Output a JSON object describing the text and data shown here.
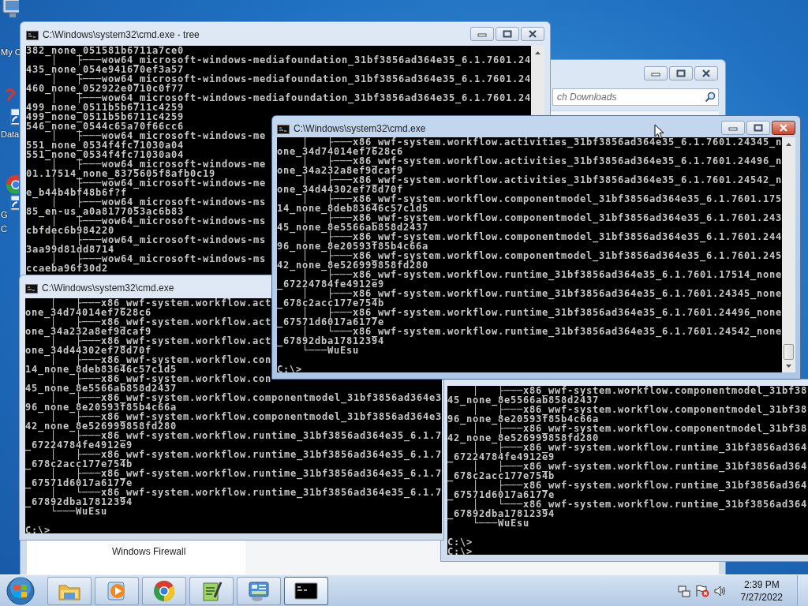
{
  "desktop_icons": [
    {
      "label": [
        "My C"
      ]
    },
    {
      "label": [
        "Data"
      ]
    },
    {
      "label": [
        "G",
        "C"
      ]
    }
  ],
  "explorer": {
    "search": {
      "placeholder": "ch Downloads"
    },
    "nav_items": [
      "Windows Firewall"
    ]
  },
  "windows": [
    {
      "title": "C:\\Windows\\system32\\cmd.exe - tree",
      "active": false,
      "lines": [
        "382_none_051581b6711a7ce0",
        "    │   ├───wow64_microsoft-windows-mediafoundation_31bf3856ad364e35_6.1.7601.24",
        "435_none_054e941670ef3a57",
        "    │   ├───wow64_microsoft-windows-mediafoundation_31bf3856ad364e35_6.1.7601.24",
        "460_none_052922e0710c0f77",
        "    │   ├───wow64_microsoft-windows-mediafoundation_31bf3856ad364e35_6.1.7601.24",
        "499_none_0511b5b6711c4259",
        "499_none_0511b5b6711c4259",
        "546_none_0544c65a70f66cc6",
        "    │   ├───wow64_microsoft-windows-me",
        "551_none_0534f4fc71030a04",
        "551_none_0534f4fc71030a04",
        "    │   ├───wow64_microsoft-windows-me",
        "01.17514_none_8375605f8afb0c19",
        "    │   ├───wow64_microsoft-windows-me",
        "e_b44b4bf48b6f?f",
        "    │   ├───wow64_microsoft-windows-ms",
        "85_en-us_a0a8177053ac6b83",
        "    │   ├───wow64_microsoft-windows-ms",
        "cbfdec6b984220",
        "    │   ├───wow64_microsoft-windows-ms",
        "3aa99d81dd8714",
        "    │   ├───wow64_microsoft-windows-ms",
        "ccaeba96f30d2"
      ]
    },
    {
      "title": "C:\\Windows\\system32\\cmd.exe",
      "active": true,
      "lines": [
        "    │   ├───x86_wwf-system.workflow.activities_31bf3856ad364e35_6.1.7601.24345_n",
        "one_34d74014ef7628c6",
        "    │   ├───x86_wwf-system.workflow.activities_31bf3856ad364e35_6.1.7601.24496_n",
        "one_34a232a8ef9dcaf9",
        "    │   ├───x86_wwf-system.workflow.activities_31bf3856ad364e35_6.1.7601.24542_n",
        "one_34d44302ef78d70f",
        "    │   ├───x86_wwf-system.workflow.componentmodel_31bf3856ad364e35_6.1.7601.175",
        "14_none_8deb83646c57c1d5",
        "    │   ├───x86_wwf-system.workflow.componentmodel_31bf3856ad364e35_6.1.7601.243",
        "45_none_8e5566ab858d2437",
        "    │   ├───x86_wwf-system.workflow.componentmodel_31bf3856ad364e35_6.1.7601.244",
        "96_none_8e20593f85b4c66a",
        "    │   ├───x86_wwf-system.workflow.componentmodel_31bf3856ad364e35_6.1.7601.245",
        "42_none_8e526999858fd280",
        "    │   ├───x86_wwf-system.workflow.runtime_31bf3856ad364e35_6.1.7601.17514_none",
        "_67224784fe4912e9",
        "    │   ├───x86_wwf-system.workflow.runtime_31bf3856ad364e35_6.1.7601.24345_none",
        "_678c2acc177e754b",
        "    │   ├───x86_wwf-system.workflow.runtime_31bf3856ad364e35_6.1.7601.24496_none",
        "_67571d6017a6177e",
        "    │   └───x86_wwf-system.workflow.runtime_31bf3856ad364e35_6.1.7601.24542_none",
        "_67892dba17812394",
        "    └───WuEsu"
      ],
      "prompts": [
        "C:\\>"
      ]
    },
    {
      "title": "C:\\Windows\\system32\\cmd.exe",
      "active": false,
      "lines": [
        "    │   ├───x86_wwf-system.workflow.act",
        "one_34d74014ef7628c6",
        "    │   ├───x86_wwf-system.workflow.act",
        "one_34a232a8ef9dcaf9",
        "    │   ├───x86_wwf-system.workflow.act",
        "one_34d44302ef78d70f",
        "    │   ├───x86_wwf-system.workflow.con",
        "14_none_8deb83646c57c1d5",
        "    │   ├───x86_wwf-system.workflow.con",
        "45_none_8e5566ab858d2437",
        "    │   ├───x86_wwf-system.workflow.componentmodel_31bf3856ad364e3",
        "96_none_8e20593f85b4c66a",
        "    │   ├───x86_wwf-system.workflow.componentmodel_31bf3856ad364e3",
        "42_none_8e526999858fd280",
        "    │   ├───x86_wwf-system.workflow.runtime_31bf3856ad364e35_6.1.7",
        "_67224784fe4912e9",
        "    │   ├───x86_wwf-system.workflow.runtime_31bf3856ad364e35_6.1.7",
        "_678c2acc177e754b",
        "    │   ├───x86_wwf-system.workflow.runtime_31bf3856ad364e35_6.1.7",
        "_67571d6017a6177e",
        "    │   └───x86_wwf-system.workflow.runtime_31bf3856ad364e35_6.1.7",
        "_67892dba17812394",
        "    └───WuEsu"
      ],
      "prompts": [
        "C:\\>"
      ]
    },
    {
      "active": false,
      "lines": [
        "    │   ├───x86_wwf-system.workflow.componentmodel_31bf38",
        "45_none_8e5566ab858d2437",
        "    │   ├───x86_wwf-system.workflow.componentmodel_31bf38",
        "96_none_8e20593f85b4c66a",
        "    │   ├───x86_wwf-system.workflow.componentmodel_31bf38",
        "42_none_8e526999858fd280",
        "    │   ├───x86_wwf-system.workflow.runtime_31bf3856ad364",
        "_67224784fe4912e9",
        "    │   ├───x86_wwf-system.workflow.runtime_31bf3856ad364",
        "_678c2acc177e754b",
        "    │   ├───x86_wwf-system.workflow.runtime_31bf3856ad364",
        "_67571d6017a6177e",
        "    │   └───x86_wwf-system.workflow.runtime_31bf3856ad364",
        "_67892dba17812394",
        "    └───WuEsu"
      ],
      "prompts": [
        "C:\\>",
        "C:\\>"
      ]
    }
  ],
  "taskbar": {
    "apps": [
      {
        "kind": "explorer",
        "selected": false
      },
      {
        "kind": "media",
        "selected": false
      },
      {
        "kind": "browser",
        "selected": false
      },
      {
        "kind": "editor",
        "selected": false
      },
      {
        "kind": "settings",
        "selected": false
      },
      {
        "kind": "console",
        "selected": true
      }
    ],
    "clock": {
      "time": "2:39 PM",
      "date": "7/27/2022"
    }
  }
}
